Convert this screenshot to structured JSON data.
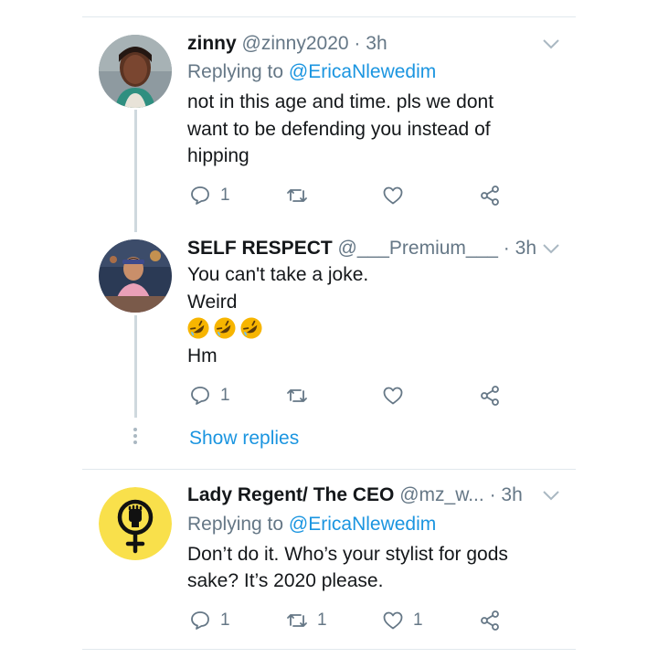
{
  "colors": {
    "accent": "#1b95e0",
    "muted": "#657786",
    "text": "#14171a",
    "divider": "#e1e8ed"
  },
  "tweets": [
    {
      "name": "zinny",
      "handle": "@zinny2020",
      "separator": "·",
      "time": "3h",
      "replying_prefix": "Replying to",
      "replying_to": "@EricaNlewedim",
      "body": [
        "not in this age and time. pls we dont",
        "want to be defending you instead of",
        "hipping"
      ],
      "reply_count": "1",
      "retweet_count": "",
      "like_count": ""
    },
    {
      "name": "SELF RESPECT",
      "handle": "@___Premium___",
      "separator": "·",
      "time": "3h",
      "body": [
        "You can't take a joke.",
        "Weird"
      ],
      "emoji": [
        "rolling-on-floor-laughing-emoji",
        "rolling-on-floor-laughing-emoji",
        "rolling-on-floor-laughing-emoji"
      ],
      "body_after": "Hm",
      "reply_count": "1",
      "retweet_count": "",
      "like_count": "",
      "show_replies": "Show replies"
    },
    {
      "name": "Lady Regent/ The CEO",
      "handle": "@mz_w...",
      "separator": "·",
      "time": "3h",
      "replying_prefix": "Replying to",
      "replying_to": "@EricaNlewedim",
      "body": [
        "Don’t do it. Who’s your stylist for gods",
        "sake?  It’s 2020 please."
      ],
      "reply_count": "1",
      "retweet_count": "1",
      "like_count": "1"
    }
  ],
  "icons": {
    "reply": "reply-icon",
    "retweet": "retweet-icon",
    "like": "heart-icon",
    "share": "share-icon",
    "menu": "chevron-down-icon"
  }
}
